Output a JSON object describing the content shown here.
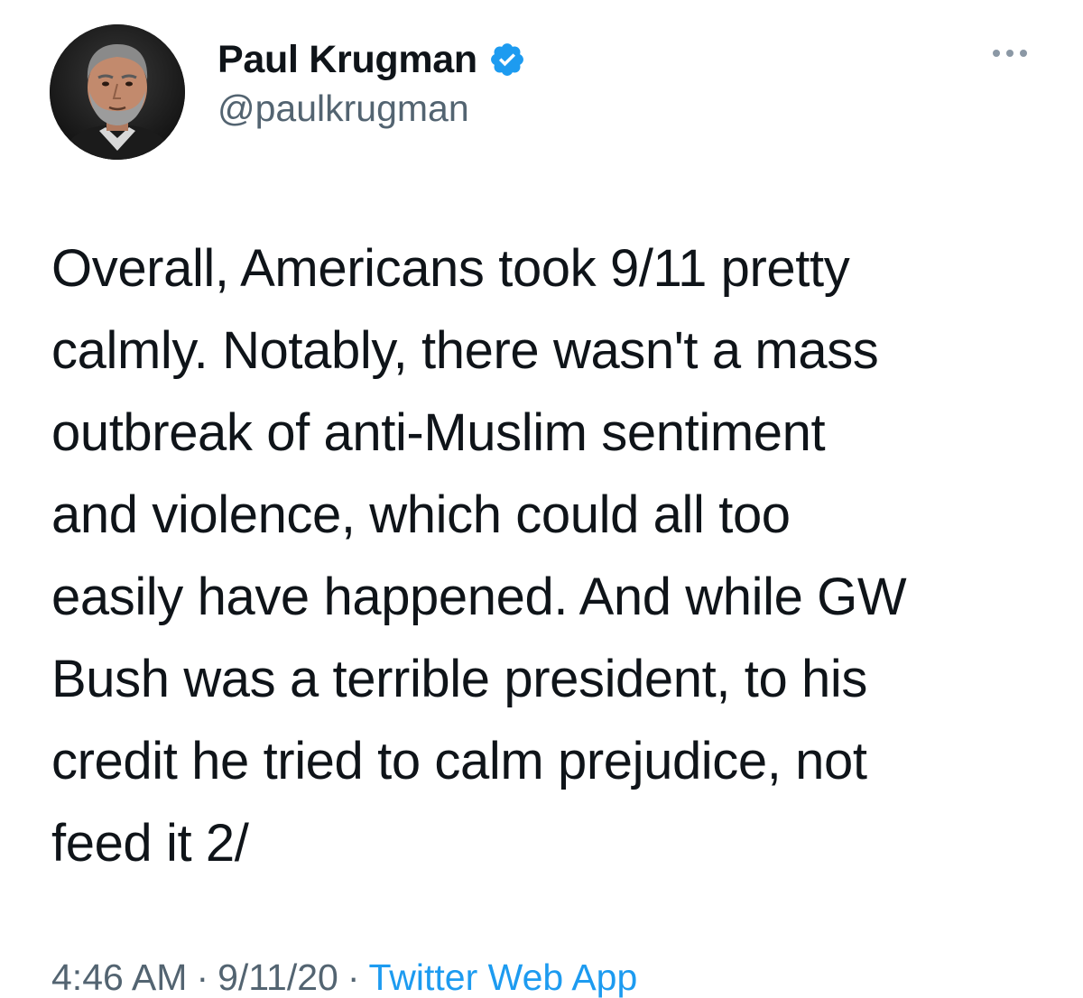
{
  "author": {
    "display_name": "Paul Krugman",
    "handle": "@paulkrugman",
    "verified": true,
    "avatar_icon": "profile-photo"
  },
  "tweet": {
    "text": "Overall, Americans took 9/11 pretty\ncalmly. Notably, there wasn't a mass\noutbreak of anti-Muslim sentiment\nand violence, which could all too\neasily have happened. And while GW\nBush was a terrible president, to his\ncredit he tried to calm prejudice, not\nfeed it 2/"
  },
  "meta": {
    "time": "4:46 AM",
    "separator": "·",
    "date": "9/11/20",
    "source": "Twitter Web App"
  },
  "colors": {
    "text": "#0f1419",
    "secondary": "#536471",
    "accent": "#1d9bf0"
  },
  "icons": {
    "verified": "verified-badge-icon",
    "more": "more-options-icon"
  }
}
